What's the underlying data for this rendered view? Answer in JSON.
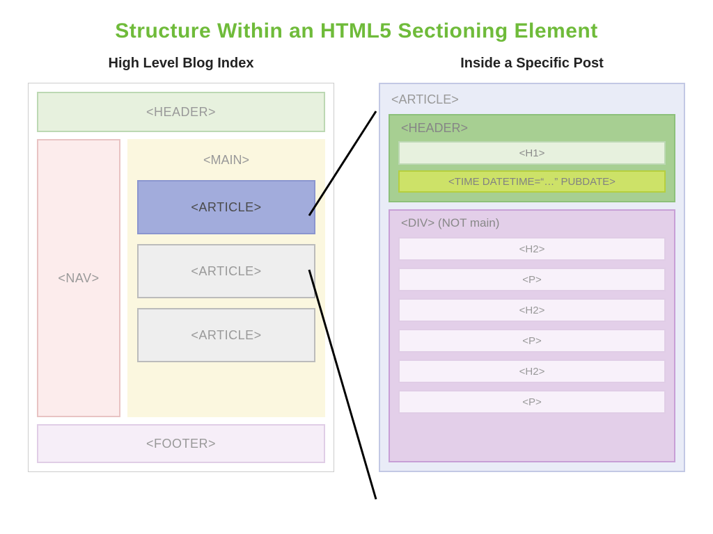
{
  "title": "Structure Within an HTML5 Sectioning Element",
  "left": {
    "heading": "High Level Blog Index",
    "header": "<HEADER>",
    "nav": "<NAV>",
    "main": "<MAIN>",
    "article": "<ARTICLE>",
    "footer": "<FOOTER>"
  },
  "right": {
    "heading": "Inside a Specific Post",
    "article": "<ARTICLE>",
    "header": "<HEADER>",
    "h1": "<H1>",
    "time": "<TIME DATETIME=“…” PUBDATE>",
    "div": "<DIV> (NOT main)",
    "h2": "<H2>",
    "p": "<P>"
  }
}
